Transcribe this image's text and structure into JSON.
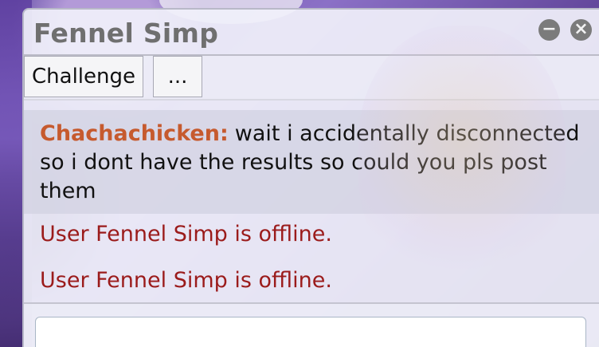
{
  "window": {
    "title": "Fennel Simp",
    "minimize_glyph": "−",
    "close_glyph": "×"
  },
  "buttons": {
    "challenge_label": "Challenge",
    "more_label": "..."
  },
  "chat": {
    "message": {
      "user": "Chachachicken:",
      "text": "wait i accidentally disconnected so i dont have the results so could you pls post them"
    },
    "notices": [
      "User Fennel Simp is offline.",
      "User Fennel Simp is offline."
    ]
  },
  "input": {
    "value": "",
    "placeholder": ""
  },
  "colors": {
    "username": "#c65a2e",
    "notice": "#9b1b1b",
    "title": "#6f6f6f"
  },
  "icons": {
    "minimize": "minus-circle-icon",
    "close": "close-circle-icon"
  }
}
